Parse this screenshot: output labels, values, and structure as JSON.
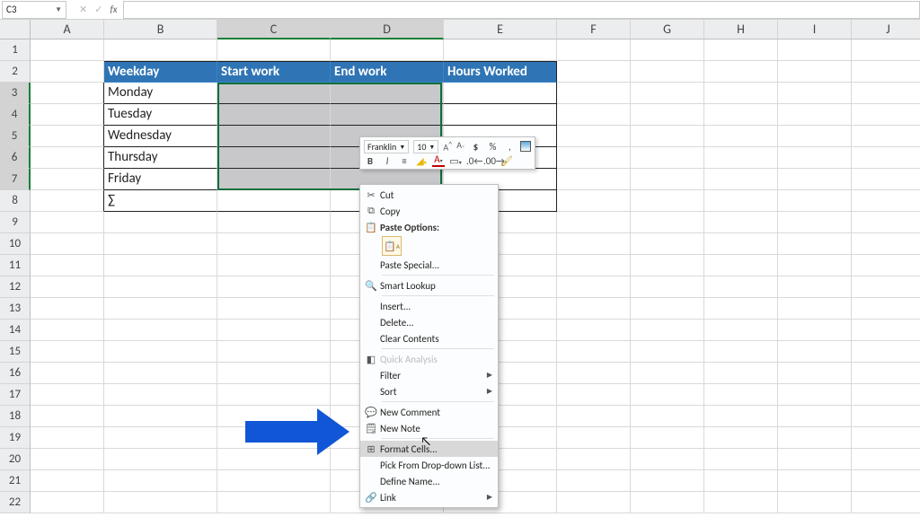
{
  "activeCell": "C3",
  "formula": "",
  "columns": [
    "A",
    "B",
    "C",
    "D",
    "E",
    "F",
    "G",
    "H",
    "I",
    "J"
  ],
  "rows": [
    "1",
    "2",
    "3",
    "4",
    "5",
    "6",
    "7",
    "8",
    "9",
    "10",
    "11",
    "12",
    "13",
    "14",
    "15",
    "16",
    "17",
    "18",
    "19",
    "20",
    "21",
    "22"
  ],
  "table": {
    "headers": [
      "Weekday",
      "Start work",
      "End work",
      "Hours Worked"
    ],
    "days": [
      "Monday",
      "Tuesday",
      "Wednesday",
      "Thursday",
      "Friday"
    ],
    "sumLabel": "∑"
  },
  "miniToolbar": {
    "font": "Franklin",
    "size": "10",
    "btns_row1": [
      "A↑",
      "A↓",
      "$",
      "%",
      "🤜",
      "⊞"
    ],
    "btns_row2": [
      "B",
      "I",
      "≡",
      "🖍",
      "A",
      "▭",
      "⇤",
      "⇥",
      "✎"
    ]
  },
  "contextMenu": {
    "cut": "Cut",
    "copy": "Copy",
    "pasteHeader": "Paste Options:",
    "pasteSpecial": "Paste Special...",
    "smartLookup": "Smart Lookup",
    "insert": "Insert...",
    "delete": "Delete...",
    "clear": "Clear Contents",
    "quick": "Quick Analysis",
    "filter": "Filter",
    "sort": "Sort",
    "newComment": "New Comment",
    "newNote": "New Note",
    "formatCells": "Format Cells...",
    "pickList": "Pick From Drop-down List...",
    "defineName": "Define Name...",
    "link": "Link"
  },
  "chart_data": {
    "type": "table",
    "categories": [],
    "values": []
  }
}
